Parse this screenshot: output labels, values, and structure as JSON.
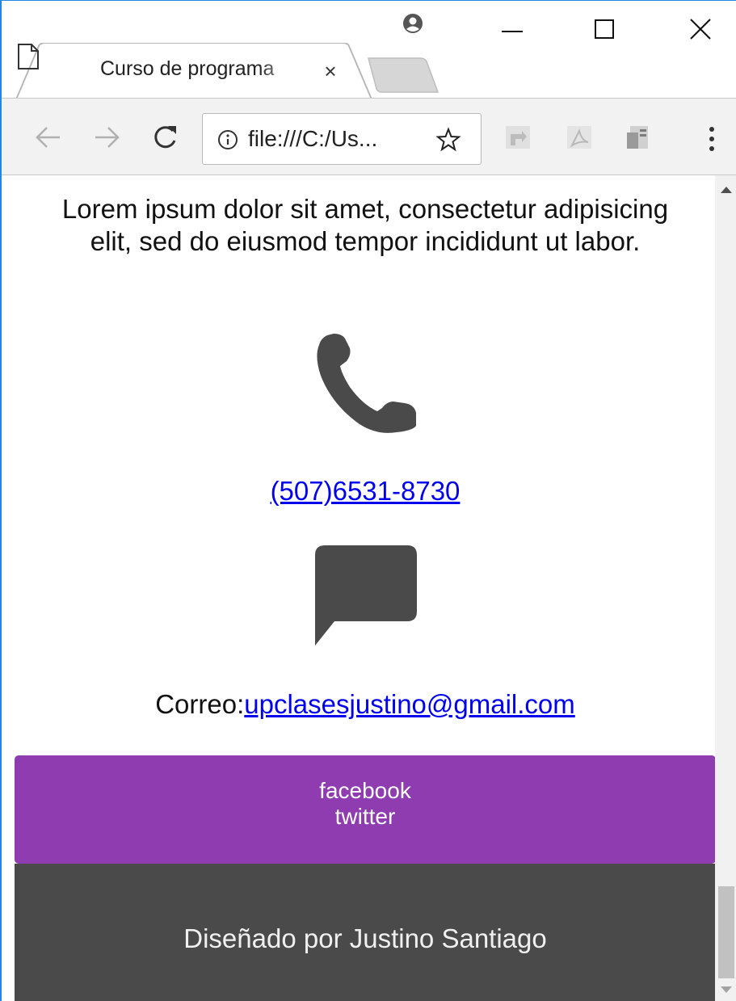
{
  "browser": {
    "tab": {
      "title": "Curso de programa",
      "close_glyph": "×",
      "icon": "document-icon"
    },
    "address_bar": {
      "url": "file:///C:/Us...",
      "security_icon": "info-icon"
    },
    "nav": {
      "back_icon": "back-arrow-icon",
      "forward_icon": "forward-arrow-icon",
      "reload_icon": "reload-icon"
    },
    "colors": {
      "frame_accent": "#1e88e5",
      "toolbar_bg": "#f2f2f2"
    }
  },
  "page": {
    "intro_text": "Lorem ipsum dolor sit amet, consectetur adipisicing elit, sed do eiusmod tempor incididunt ut labor.",
    "phone": {
      "icon": "phone-icon",
      "number": "(507)6531-8730"
    },
    "message": {
      "icon": "chat-icon"
    },
    "email": {
      "label": "Correo:",
      "address": "upclasesjustino@gmail.com"
    },
    "social": {
      "links": [
        "facebook",
        "twitter"
      ],
      "bg_color": "#8e3caf"
    },
    "footer": {
      "text": "Diseñado por Justino Santiago",
      "bg_color": "#4a4a4a"
    },
    "colors": {
      "link": "#0000ee",
      "icon": "#4a4a4a"
    }
  }
}
